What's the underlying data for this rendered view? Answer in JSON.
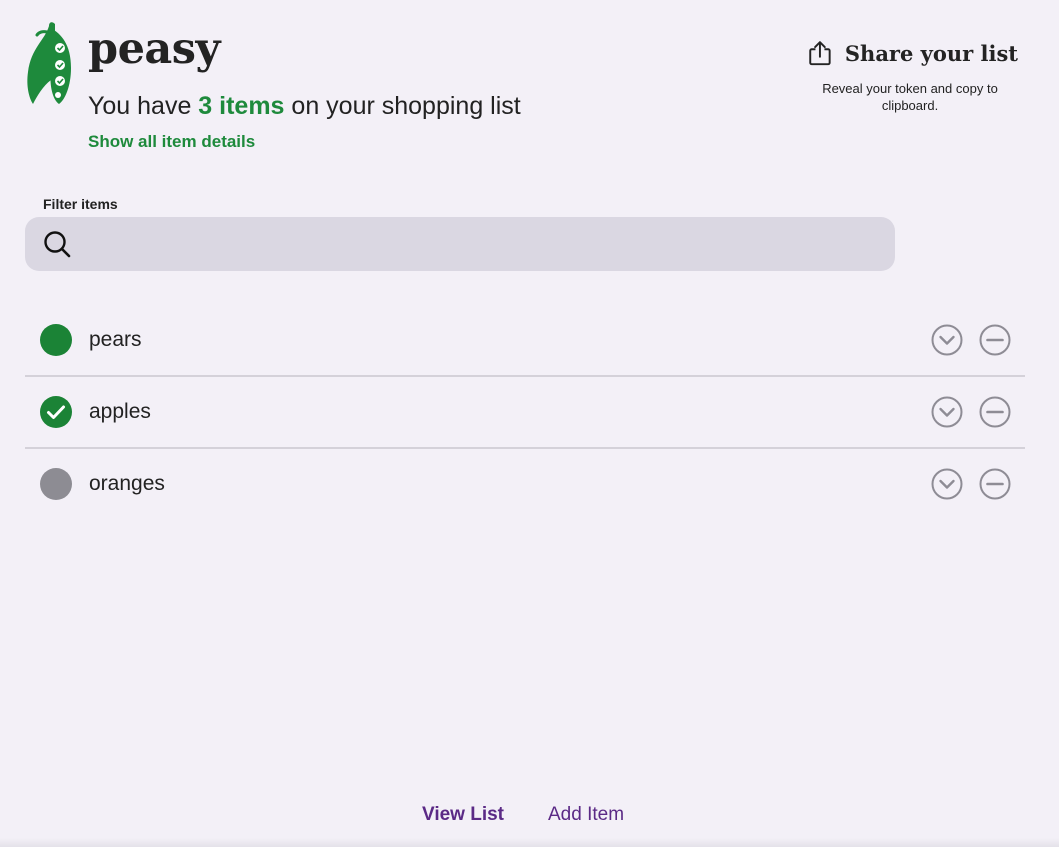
{
  "app": {
    "brand": "peasy",
    "logo_icon": "pea-pod-icon",
    "brand_color": "#1e8a3c",
    "accent_color": "#5b2a86"
  },
  "header": {
    "summary_prefix": "You have ",
    "summary_count": "3 items",
    "summary_suffix": " on your shopping list",
    "show_details_label": "Show all item details"
  },
  "share": {
    "icon": "share-icon",
    "title": "Share your list",
    "description": "Reveal your token and copy to clipboard."
  },
  "filter": {
    "label": "Filter items",
    "value": "",
    "placeholder": "",
    "icon": "search-icon"
  },
  "items": [
    {
      "name": "pears",
      "state": "needed",
      "state_color": "#1b8336"
    },
    {
      "name": "apples",
      "state": "purchased",
      "state_color": "#1b8336"
    },
    {
      "name": "oranges",
      "state": "inactive",
      "state_color": "#8d8c93"
    }
  ],
  "nav": {
    "view_list": "View List",
    "add_item": "Add Item"
  }
}
